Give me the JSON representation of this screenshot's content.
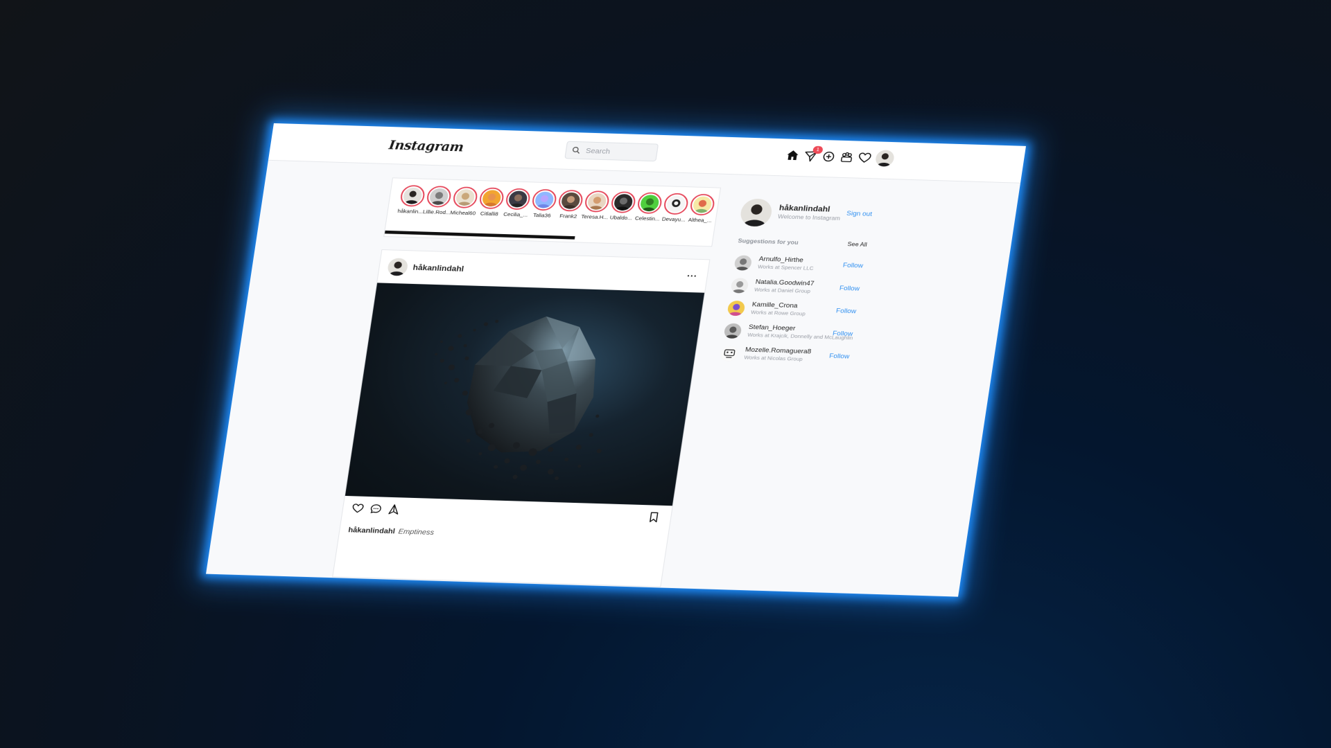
{
  "nav": {
    "logo": "Instagram",
    "search_placeholder": "Search",
    "message_badge": "1",
    "icons": [
      "home-icon",
      "direct-message-icon",
      "new-post-icon",
      "explore-icon",
      "activity-heart-icon",
      "profile-avatar"
    ]
  },
  "stories": [
    {
      "name": "håkanlin..."
    },
    {
      "name": "Lillie.Rod..."
    },
    {
      "name": "Micheal60"
    },
    {
      "name": "Citlalli8"
    },
    {
      "name": "Cecilia_..."
    },
    {
      "name": "Talia36"
    },
    {
      "name": "Frank2"
    },
    {
      "name": "Teresa.H..."
    },
    {
      "name": "Ubaldo..."
    },
    {
      "name": "Celestin..."
    },
    {
      "name": "Devayu..."
    },
    {
      "name": "Althea_..."
    }
  ],
  "stories_progress": 0.58,
  "post": {
    "username": "håkanlindahl",
    "more_label": "...",
    "caption_user": "håkanlindahl",
    "caption_text": "Emptiness"
  },
  "sidebar": {
    "username": "håkanlindahl",
    "subtitle": "Welcome to Instagram",
    "signout_label": "Sign out",
    "suggestions_title": "Suggestions for you",
    "see_all_label": "See All",
    "suggestions": [
      {
        "name": "Arnulfo_Hirthe",
        "sub": "Works at Spencer LLC",
        "follow": "Follow"
      },
      {
        "name": "Natalia.Goodwin47",
        "sub": "Works at Daniel Group",
        "follow": "Follow"
      },
      {
        "name": "Kamille_Crona",
        "sub": "Works at Rowe Group",
        "follow": "Follow"
      },
      {
        "name": "Stefan_Hoeger",
        "sub": "Works at Krajcik, Donnelly and McLaughlin",
        "follow": "Follow"
      },
      {
        "name": "Mozelle.Romaguera8",
        "sub": "Works at Nicolas Group",
        "follow": "Follow"
      }
    ]
  },
  "colors": {
    "accent_blue": "#2f8ff0",
    "story_ring": "#e5475a",
    "badge": "#ed4956",
    "glow": "#1f8fff"
  }
}
